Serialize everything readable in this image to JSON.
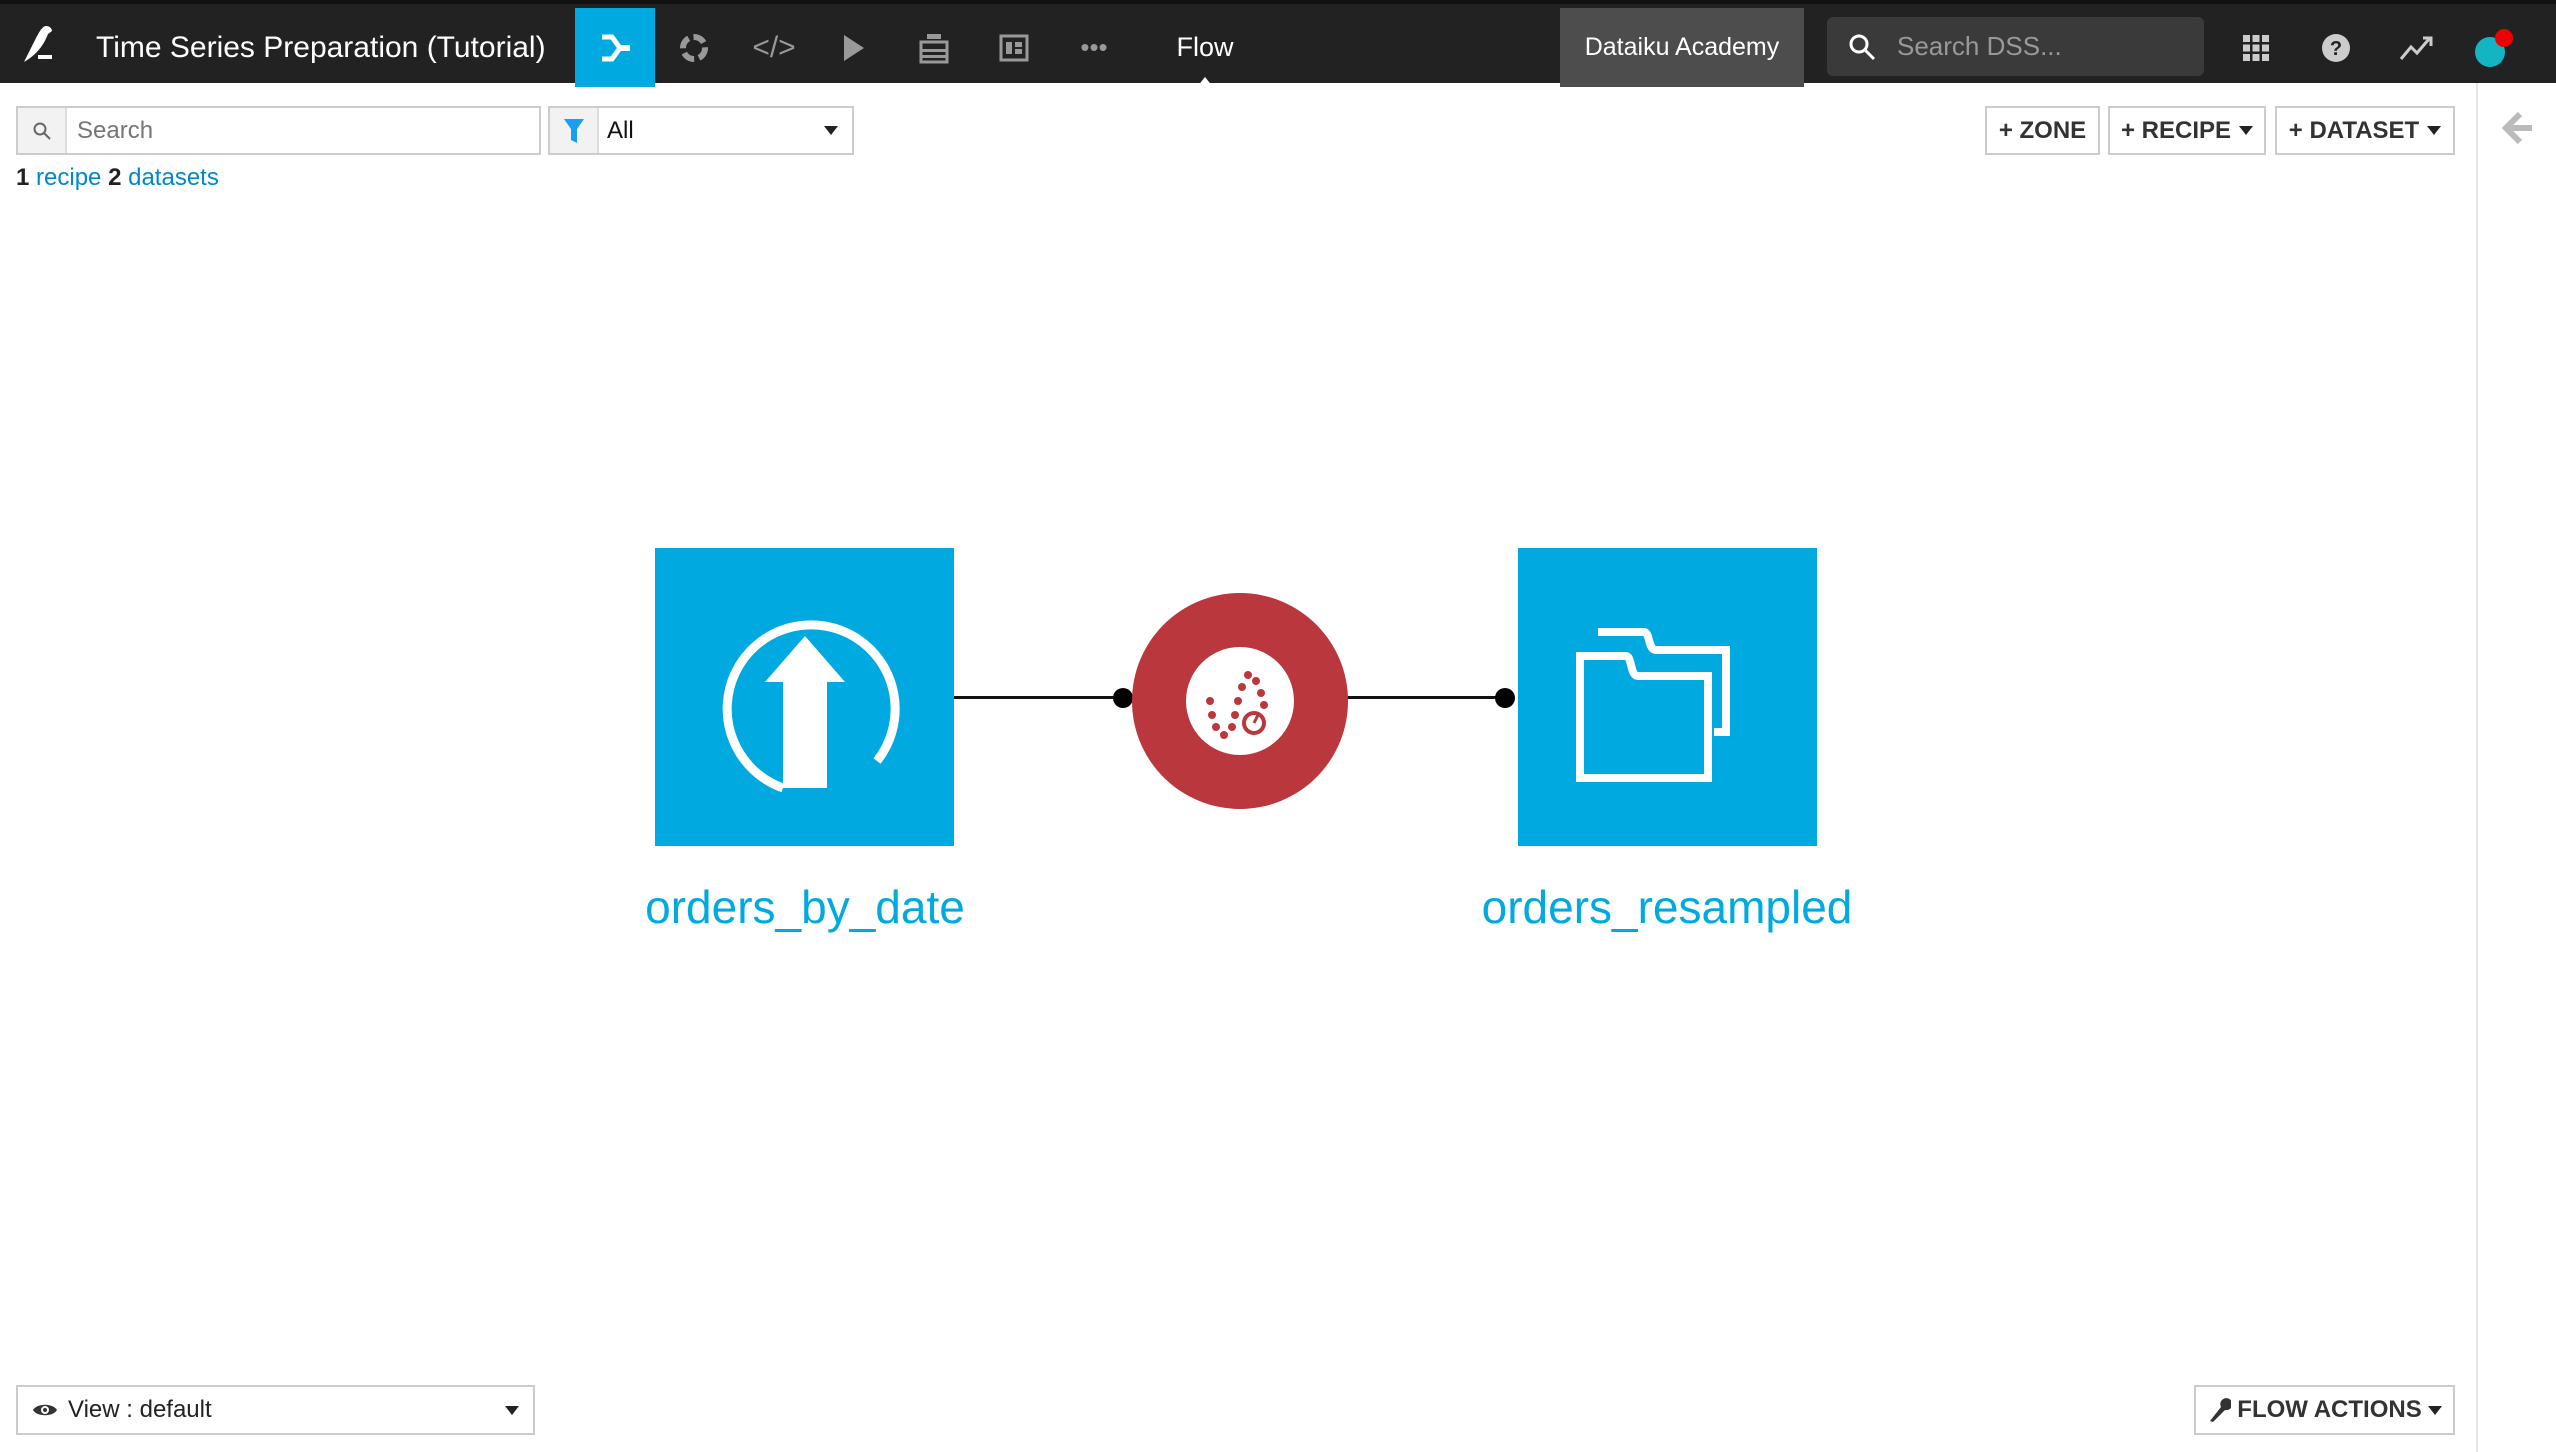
{
  "topbar": {
    "project_title": "Time Series Preparation (Tutorial)",
    "nav_icons": [
      "flow-icon",
      "recipes-circle-icon",
      "code-icon",
      "play-icon",
      "datasets-stack-icon",
      "dashboard-icon",
      "more-icon"
    ],
    "active_section": "Flow",
    "instance_label": "Dataiku Academy",
    "search_placeholder": "Search DSS...",
    "accent_color": "#00aae0"
  },
  "toolbar": {
    "search_placeholder": "Search",
    "filter_value": "All",
    "summary": {
      "recipe_count": "1",
      "recipe_label": "recipe",
      "dataset_count": "2",
      "dataset_label": "datasets"
    },
    "zone_button": "+ ZONE",
    "recipe_button": "+ RECIPE",
    "dataset_button": "+ DATASET"
  },
  "flow": {
    "input_dataset": {
      "name": "orders_by_date",
      "icon": "upload-icon",
      "color": "#00aae0"
    },
    "recipe": {
      "type": "time-series-resampling",
      "icon": "resample-icon",
      "color": "#b9373d"
    },
    "output_dataset": {
      "name": "orders_resampled",
      "icon": "folder-icon",
      "color": "#00aae0"
    }
  },
  "footer": {
    "view_label": "View : default",
    "flow_actions": "FLOW ACTIONS"
  }
}
